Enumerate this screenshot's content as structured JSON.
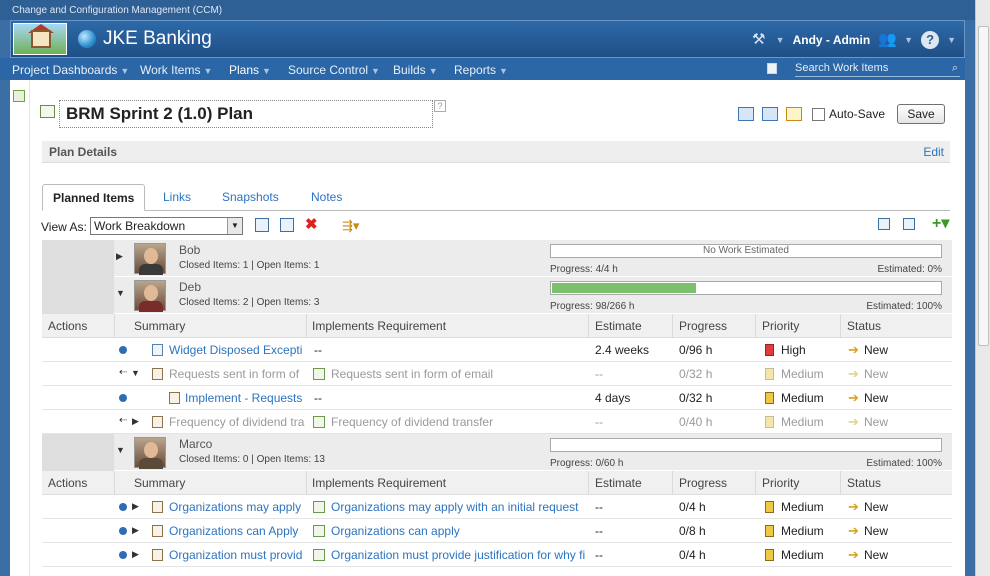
{
  "topbar": {
    "title": "Change and Configuration Management (CCM)"
  },
  "banner": {
    "app": "JKE Banking",
    "user": "Andy - Admin",
    "help": "?"
  },
  "nav": {
    "items": [
      {
        "label": "Project Dashboards"
      },
      {
        "label": "Work Items"
      },
      {
        "label": "Plans"
      },
      {
        "label": "Source Control"
      },
      {
        "label": "Builds"
      },
      {
        "label": "Reports"
      }
    ],
    "search_placeholder": "Search Work Items"
  },
  "plan": {
    "title": "BRM Sprint 2 (1.0) Plan",
    "autosave_label": "Auto-Save",
    "save_label": "Save"
  },
  "details": {
    "label": "Plan Details",
    "edit": "Edit"
  },
  "tabs": [
    "Planned Items",
    "Links",
    "Snapshots",
    "Notes"
  ],
  "view": {
    "label": "View As:",
    "selected": "Work Breakdown"
  },
  "columns": [
    "Actions",
    "Summary",
    "Implements Requirement",
    "Estimate",
    "Progress",
    "Priority",
    "Status"
  ],
  "owners": {
    "bob": {
      "name": "Bob",
      "counts": "Closed Items: 1 | Open Items: 1",
      "bar_text": "No Work Estimated",
      "progress_fraction": 0,
      "progress": "Progress: 4/4 h",
      "estimated": "Estimated: 0%"
    },
    "deb": {
      "name": "Deb",
      "counts": "Closed Items: 2 | Open Items: 3",
      "bar_text": "",
      "progress_fraction": 0.37,
      "progress": "Progress: 98/266 h",
      "estimated": "Estimated: 100%"
    },
    "marco": {
      "name": "Marco",
      "counts": "Closed Items: 0 | Open Items: 13",
      "bar_text": "",
      "progress_fraction": 0,
      "progress": "Progress: 0/60 h",
      "estimated": "Estimated: 100%"
    }
  },
  "deb_rows": [
    {
      "summary": "Widget Disposed Excepti",
      "req": "--",
      "estimate": "2.4 weeks",
      "progress": "0/96 h",
      "priority": "High",
      "status": "New"
    },
    {
      "summary": "Requests sent in form of",
      "req": "Requests sent in form of email",
      "estimate": "--",
      "progress": "0/32 h",
      "priority": "Medium",
      "status": "New"
    },
    {
      "summary": "Implement - Requests",
      "req": "--",
      "estimate": "4 days",
      "progress": "0/32 h",
      "priority": "Medium",
      "status": "New"
    },
    {
      "summary": "Frequency of dividend tra",
      "req": "Frequency of dividend transfer",
      "estimate": "--",
      "progress": "0/40 h",
      "priority": "Medium",
      "status": "New"
    }
  ],
  "marco_rows": [
    {
      "summary": "Organizations may apply",
      "req": "Organizations may apply with an initial request",
      "estimate": "--",
      "progress": "0/4 h",
      "priority": "Medium",
      "status": "New"
    },
    {
      "summary": "Organizations can Apply",
      "req": "Organizations can apply",
      "estimate": "--",
      "progress": "0/8 h",
      "priority": "Medium",
      "status": "New"
    },
    {
      "summary": "Organization must provid",
      "req": "Organization must provide justification for why fi",
      "estimate": "--",
      "progress": "0/4 h",
      "priority": "Medium",
      "status": "New"
    }
  ]
}
